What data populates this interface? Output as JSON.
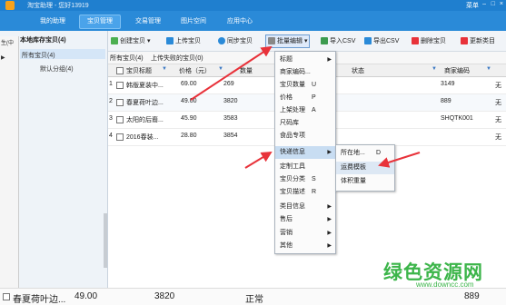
{
  "titlebar": {
    "title": "淘宝助理 - 您好13919",
    "menu": "菜单",
    "min": "–",
    "max": "□",
    "close": "×"
  },
  "nav": {
    "tabs": [
      "我的助理",
      "宝贝管理",
      "交易管理",
      "图片空间",
      "应用中心"
    ],
    "active": 1
  },
  "left": {
    "header": "本地库存宝贝(4)",
    "items": [
      "所有宝贝(4)",
      "默认分组(4)"
    ],
    "strip": [
      "生(中",
      "▶"
    ]
  },
  "toolbar": {
    "create": "创建宝贝",
    "upload": "上传宝贝",
    "sync": "同步宝贝",
    "batch": "批量编辑",
    "import": "导入CSV",
    "export": "导出CSV",
    "delete": "删除宝贝",
    "update": "更新类目"
  },
  "subtabs": [
    "所有宝贝(4)",
    "上传失败的宝贝(0)"
  ],
  "table": {
    "headers": {
      "title": "宝贝标题",
      "price": "价格（元）",
      "qty": "数量",
      "status": "状态",
      "code": "商家编码"
    },
    "rows": [
      {
        "n": "1",
        "title": "韩版夏装中...",
        "price": "69.00",
        "qty": "269",
        "code": "3149",
        "flag": "无"
      },
      {
        "n": "2",
        "title": "春夏荷叶边...",
        "price": "49.00",
        "qty": "3820",
        "code": "889",
        "flag": "无"
      },
      {
        "n": "3",
        "title": "太阳的后裔...",
        "price": "45.90",
        "qty": "3583",
        "code": "SHQTK001",
        "flag": "无"
      },
      {
        "n": "4",
        "title": "2016春装...",
        "price": "28.80",
        "qty": "3854",
        "code": "",
        "flag": "无"
      }
    ]
  },
  "menu": {
    "items": [
      {
        "label": "标题",
        "key": "",
        "arrow": "▶"
      },
      {
        "label": "商家编码...",
        "key": "",
        "arrow": ""
      },
      {
        "label": "宝贝数量",
        "key": "U",
        "arrow": ""
      },
      {
        "label": "价格",
        "key": "P",
        "arrow": ""
      },
      {
        "label": "上架处理",
        "key": "A",
        "arrow": ""
      },
      {
        "label": "尺码库",
        "key": "",
        "arrow": ""
      },
      {
        "label": "食品专项",
        "key": "",
        "arrow": ""
      },
      {
        "label": "快递信息",
        "key": "",
        "arrow": "▶"
      },
      {
        "label": "定制工具",
        "key": "",
        "arrow": ""
      },
      {
        "label": "宝贝分类",
        "key": "S",
        "arrow": ""
      },
      {
        "label": "宝贝描述",
        "key": "R",
        "arrow": ""
      },
      {
        "label": "类目信息",
        "key": "",
        "arrow": "▶"
      },
      {
        "label": "售后",
        "key": "",
        "arrow": "▶"
      },
      {
        "label": "营销",
        "key": "",
        "arrow": "▶"
      },
      {
        "label": "其他",
        "key": "",
        "arrow": "▶"
      }
    ],
    "submenu": [
      {
        "label": "所在地...",
        "key": "D"
      },
      {
        "label": "运费模板",
        "key": ""
      },
      {
        "label": "体积重量",
        "key": ""
      }
    ]
  },
  "bottom": {
    "title": "春夏荷叶边...",
    "price": "49.00",
    "qty": "3820",
    "status": "正常",
    "code": "889"
  },
  "watermark": {
    "big": "绿色资源网",
    "small": "www.downcc.com"
  },
  "colors": {
    "nav": "#2a8ad8",
    "accent": "#e8323a",
    "watermark": "#3cb54a"
  }
}
